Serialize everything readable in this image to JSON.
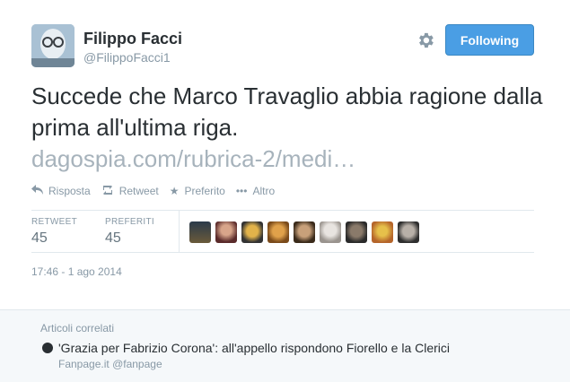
{
  "tweet": {
    "name": "Filippo Facci",
    "handle": "@FilippoFacci1",
    "follow_label": "Following",
    "text": "Succede che Marco Travaglio abbia ragione dalla prima all'ultima riga.",
    "link": "dagospia.com/rubrica-2/medi…",
    "actions": {
      "reply": "Risposta",
      "retweet": "Retweet",
      "favorite": "Preferito",
      "more": "Altro"
    },
    "stats": {
      "retweet_label": "RETWEET",
      "retweet_count": "45",
      "favorites_label": "PREFERITI",
      "favorites_count": "45"
    },
    "timestamp": "17:46 - 1 ago 2014"
  },
  "related": {
    "heading": "Articoli correlati",
    "title": "'Grazia per Fabrizio Corona': all'appello rispondono Fiorello e la Clerici",
    "source": "Fanpage.it",
    "source_handle": "@fanpage"
  },
  "icons": {
    "settings": "gear-icon",
    "reply": "reply-icon",
    "retweet": "retweet-icon",
    "favorite": "star-icon",
    "more": "more-icon"
  },
  "colors": {
    "follow_button": "#4a9ee4",
    "link": "#a7b3bc",
    "muted": "#8899a6"
  }
}
